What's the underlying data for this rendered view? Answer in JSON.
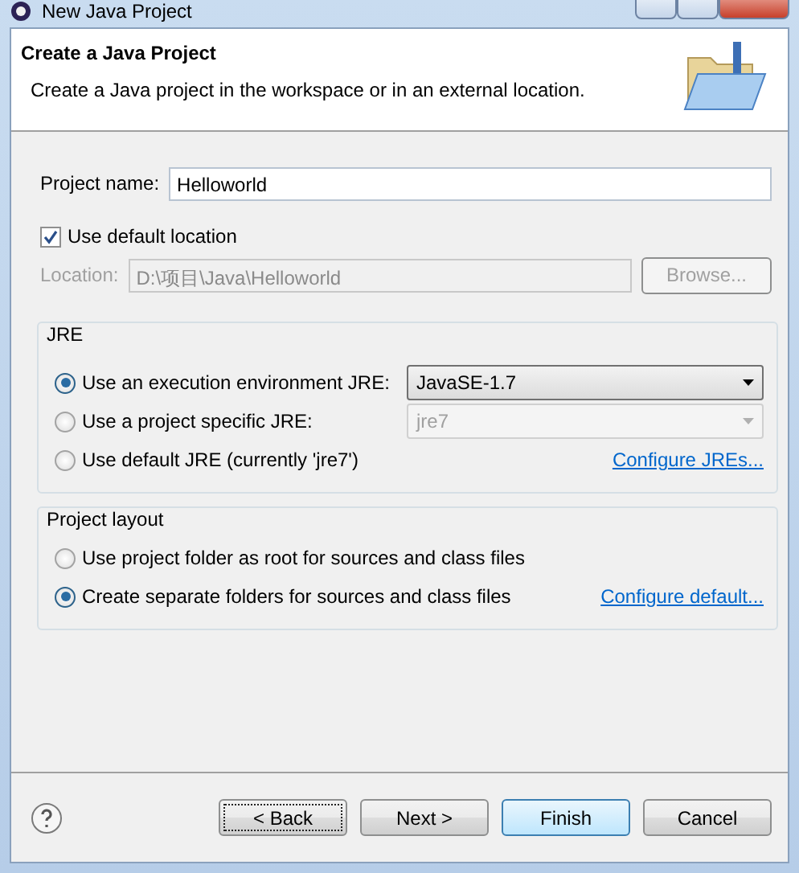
{
  "window": {
    "title": "New Java Project"
  },
  "header": {
    "title": "Create a Java Project",
    "description": "Create a Java project in the workspace or in an external location."
  },
  "project_name": {
    "label": "Project name:",
    "value": "Helloworld"
  },
  "default_location": {
    "label": "Use default location",
    "checked": true
  },
  "location": {
    "label": "Location:",
    "value": "D:\\项目\\Java\\Helloworld",
    "disabled": true
  },
  "browse_button": {
    "label": "Browse...",
    "disabled": true
  },
  "jre": {
    "title": "JRE",
    "options": [
      {
        "label": "Use an execution environment JRE:",
        "selected": true,
        "kind": "select",
        "value": "JavaSE-1.7",
        "disabled": false
      },
      {
        "label": "Use a project specific JRE:",
        "selected": false,
        "kind": "select",
        "value": "jre7",
        "disabled": true
      },
      {
        "label": "Use default JRE (currently 'jre7')",
        "selected": false,
        "kind": "link",
        "link": "Configure JREs..."
      }
    ]
  },
  "project_layout": {
    "title": "Project layout",
    "options": [
      {
        "label": "Use project folder as root for sources and class files",
        "selected": false,
        "kind": "plain"
      },
      {
        "label": "Create separate folders for sources and class files",
        "selected": true,
        "kind": "link",
        "link": "Configure default..."
      }
    ]
  },
  "buttons": [
    {
      "label": "< Back",
      "kind": "focused"
    },
    {
      "label": "Next >",
      "kind": "normal"
    },
    {
      "label": "Finish",
      "kind": "default"
    },
    {
      "label": "Cancel",
      "kind": "normal"
    }
  ]
}
